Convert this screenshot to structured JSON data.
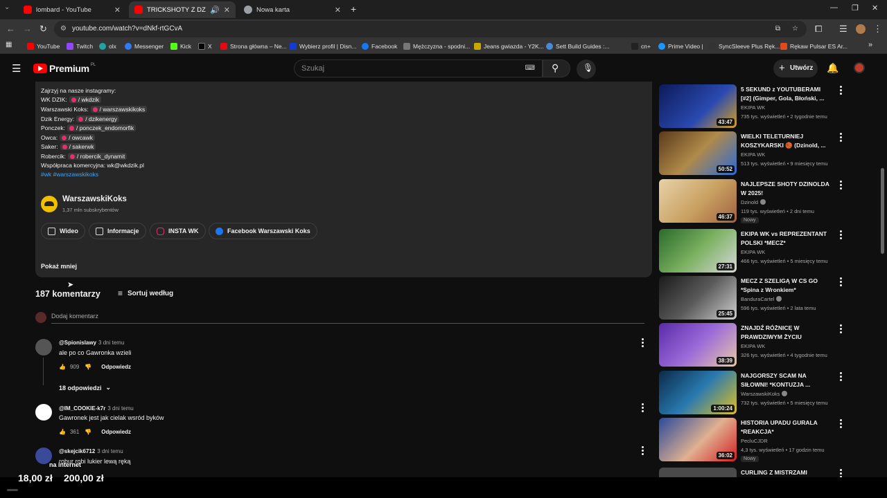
{
  "tabs": [
    {
      "title": "lombard - YouTube",
      "active": false
    },
    {
      "title": "TRICKSHOTY Z DZINOLDEM",
      "active": true
    },
    {
      "title": "Nowa karta",
      "active": false
    }
  ],
  "address": "youtube.com/watch?v=dNkf-rtGCvA",
  "bookmarks": [
    "YouTube",
    "Twitch",
    "olx",
    "Messenger",
    "Kick",
    "X",
    "Strona główna – Ne...",
    "Wybierz profil | Disn...",
    "Facebook",
    "Mężczyzna - spodni...",
    "Jeans gwiazda - Y2K...",
    "Sett Build Guides :...",
    "cn+",
    "Prime Video |",
    "SyncSleeve Plus Ręk...",
    "Rękaw Pulsar ES Ar..."
  ],
  "header": {
    "logo": "Premium",
    "region": "PL",
    "search_placeholder": "Szukaj",
    "create_label": "Utwórz"
  },
  "description": {
    "lines": [
      {
        "label": "Zajrzyj na nasze instagramy:",
        "handle": ""
      },
      {
        "label": "WK DZIK:",
        "handle": "/ wkdzik"
      },
      {
        "label": "Warszawski Koks:",
        "handle": "/ warszawskikoks"
      },
      {
        "label": "Dzik Energy:",
        "handle": "/ dzikenergy"
      },
      {
        "label": "Ponczek:",
        "handle": "/ ponczek_endomorfik"
      },
      {
        "label": "Owca:",
        "handle": "/ owcawk"
      },
      {
        "label": "Saker:",
        "handle": "/ sakerwk"
      },
      {
        "label": "Robercik:",
        "handle": "/ robercik_dynamit"
      },
      {
        "label": "Współpraca komercyjna: wk@wkdzik.pl",
        "handle": ""
      }
    ],
    "tags": "#wk #warszawskikoks",
    "channel_name": "WarszawskiKoks",
    "channel_subs": "1,37 mln subskrybentów",
    "buttons": [
      "Wideo",
      "Informacje",
      "INSTA WK",
      "Facebook Warszawski Koks"
    ],
    "show_less": "Pokaż mniej"
  },
  "comments_section": {
    "count": "187 komentarzy",
    "sort": "Sortuj według",
    "add_placeholder": "Dodaj komentarz",
    "reply_label": "Odpowiedz",
    "comments": [
      {
        "author": "@Spionislawy",
        "time": "3 dni temu",
        "text": "ale po co Gawronka wzieli",
        "likes": "909",
        "replies": "18 odpowiedzi"
      },
      {
        "author": "@IM_COOKIE-k7r",
        "time": "3 dni temu",
        "text": "Gawronek jest jak cielak wsród byków",
        "likes": "361",
        "replies": ""
      },
      {
        "author": "@skejcik6712",
        "time": "3 dni temu",
        "text": "robur robi lukier lewą ręką",
        "likes": "",
        "replies": ""
      }
    ]
  },
  "sidebar": [
    {
      "title": "5 SEKUND z YOUTUBERAMI [#2] (Gimper, Gola, Błoński, ...",
      "channel": "EKIPA WK",
      "verified": false,
      "meta": "735 tys. wyświetleń • 2 tygodnie temu",
      "duration": "43:47",
      "nowy": "",
      "color": "#1a2a7a"
    },
    {
      "title": "WIELKI TELETURNIEJ KOSZYKARSKI 🏀 (Dzinold, ...",
      "channel": "EKIPA WK",
      "verified": false,
      "meta": "513 tys. wyświetleń • 9 miesięcy temu",
      "duration": "50:52",
      "nowy": "",
      "color": "#7a5a2a"
    },
    {
      "title": "NAJLEPSZE SHOTY DZINOLDA W 2025!",
      "channel": "Dzinold",
      "verified": true,
      "meta": "119 tys. wyświetleń • 2 dni temu",
      "duration": "46:37",
      "nowy": "Nowy",
      "color": "#c9a46a"
    },
    {
      "title": "EKIPA WK vs REPREZENTANT POLSKI *MECZ*",
      "channel": "EKIPA WK",
      "verified": false,
      "meta": "466 tys. wyświetleń • 5 miesięcy temu",
      "duration": "27:31",
      "nowy": "",
      "color": "#2f7a3a"
    },
    {
      "title": "MECZ Z SZELIGĄ W CS GO *Spina z Wronkiem*",
      "channel": "BanduraCartel",
      "verified": true,
      "meta": "596 tys. wyświetleń • 2 lata temu",
      "duration": "25:45",
      "nowy": "",
      "color": "#3a3a3a"
    },
    {
      "title": "ZNAJDŹ RÓŻNICĘ W PRAWDZIWYM ŻYCIU",
      "channel": "EKIPA WK",
      "verified": false,
      "meta": "326 tys. wyświetleń • 4 tygodnie temu",
      "duration": "38:39",
      "nowy": "",
      "color": "#6a3aa8"
    },
    {
      "title": "NAJGORSZY SCAM NA SIŁOWNI! *KONTUZJA ...",
      "channel": "WarszawskiKoks",
      "verified": true,
      "meta": "732 tys. wyświetleń • 5 miesięcy temu",
      "duration": "1:00:24",
      "nowy": "",
      "color": "#1a4a6a"
    },
    {
      "title": "HISTORIA UPADU GURALA *REAKCJA*",
      "channel": "PecluCJDR",
      "verified": false,
      "meta": "4,3 tys. wyświetleń • 17 godzin temu",
      "duration": "36:02",
      "nowy": "Nowy",
      "color": "#3a5aa8"
    },
    {
      "title": "CURLING Z MISTRZAMI",
      "channel": "",
      "verified": false,
      "meta": "",
      "duration": "",
      "nowy": "",
      "color": "#4a4a4a"
    }
  ],
  "overlay": {
    "label": "na internet",
    "price1": "18,00 zł",
    "price2": "200,00 zł"
  },
  "colors": {
    "bg": "#0f0f0f",
    "panel": "#272727",
    "accent_red": "#ff0000",
    "link_blue": "#3ea6ff"
  }
}
